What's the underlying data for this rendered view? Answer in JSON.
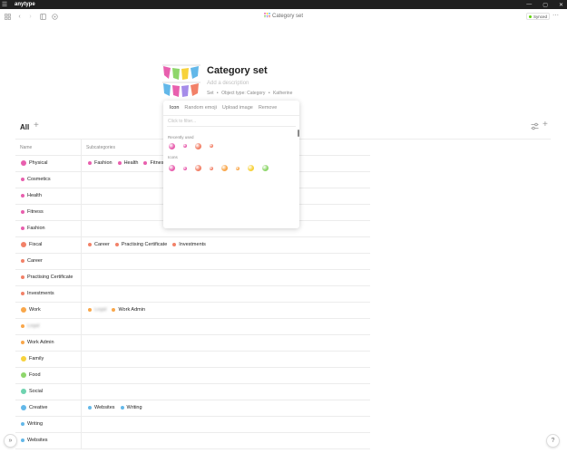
{
  "window": {
    "app_name": "anytype",
    "menu_icon": "hamburger-icon",
    "min_icon": "—",
    "max_icon": "▢",
    "close_icon": "✕"
  },
  "header": {
    "breadcrumb": "Category set",
    "sync_status": "Synced",
    "more_icon": "⋯"
  },
  "object": {
    "title": "Category set",
    "description_placeholder": "Add a description",
    "meta": [
      "Set",
      "•",
      "Object type: Category",
      "•",
      "Katherine"
    ]
  },
  "view": {
    "tab_label": "All",
    "add_view": "+",
    "add_row": "+"
  },
  "table": {
    "columns": [
      "Name",
      "Subcategories"
    ],
    "rows": [
      {
        "name": "Physical",
        "color": "#e85fae",
        "large": true,
        "subs": [
          {
            "label": "Fashion",
            "color": "#e85fae"
          },
          {
            "label": "Health",
            "color": "#e85fae"
          },
          {
            "label": "Fitness",
            "color": "#e85fae"
          }
        ]
      },
      {
        "name": "Cosmetics",
        "color": "#e85fae",
        "large": false,
        "subs": []
      },
      {
        "name": "Health",
        "color": "#e85fae",
        "large": false,
        "subs": []
      },
      {
        "name": "Fitness",
        "color": "#e85fae",
        "large": false,
        "subs": []
      },
      {
        "name": "Fashion",
        "color": "#e85fae",
        "large": false,
        "subs": []
      },
      {
        "name": "Fiscal",
        "color": "#f28168",
        "large": true,
        "subs": [
          {
            "label": "Career",
            "color": "#f28168"
          },
          {
            "label": "Practising Certificate",
            "color": "#f28168"
          },
          {
            "label": "Investments",
            "color": "#f28168"
          }
        ]
      },
      {
        "name": "Career",
        "color": "#f28168",
        "large": false,
        "subs": []
      },
      {
        "name": "Practising Certificate",
        "color": "#f28168",
        "large": false,
        "subs": []
      },
      {
        "name": "Investments",
        "color": "#f28168",
        "large": false,
        "subs": []
      },
      {
        "name": "Work",
        "color": "#f9a74b",
        "large": true,
        "subs": [
          {
            "label": "Legal",
            "color": "#f9a74b",
            "blurred": true
          },
          {
            "label": "Work Admin",
            "color": "#f9a74b"
          }
        ]
      },
      {
        "name": "Legal",
        "color": "#f9a74b",
        "large": false,
        "blurred": true,
        "subs": []
      },
      {
        "name": "Work Admin",
        "color": "#f9a74b",
        "large": false,
        "subs": []
      },
      {
        "name": "Family",
        "color": "#f7d23c",
        "large": true,
        "subs": []
      },
      {
        "name": "Food",
        "color": "#8ed66b",
        "large": true,
        "subs": []
      },
      {
        "name": "Social",
        "color": "#6fd3b0",
        "large": true,
        "subs": []
      },
      {
        "name": "Creative",
        "color": "#63b8e9",
        "large": true,
        "subs": [
          {
            "label": "Websites",
            "color": "#63b8e9"
          },
          {
            "label": "Writing",
            "color": "#63b8e9"
          }
        ]
      },
      {
        "name": "Writing",
        "color": "#63b8e9",
        "large": false,
        "subs": []
      },
      {
        "name": "Websites",
        "color": "#63b8e9",
        "large": false,
        "subs": []
      }
    ]
  },
  "popup": {
    "tabs": [
      "Icon",
      "Random emoji",
      "Upload image",
      "Remove"
    ],
    "filter_placeholder": "Click to filter...",
    "recent_label": "Recently used",
    "icons_label": "Icons",
    "recent_colors": [
      "#e85fae",
      "#e85fae",
      "#f28168",
      "#f28168"
    ],
    "recent_sizes": [
      "large",
      "small",
      "large",
      "small"
    ],
    "icon_colors": [
      "#e85fae",
      "#e85fae",
      "#f28168",
      "#f28168",
      "#f9a74b",
      "#f9a74b",
      "#f7d23c",
      "#8ed66b"
    ],
    "icon_sizes": [
      "large",
      "small",
      "large",
      "small",
      "large",
      "small",
      "large",
      "large"
    ]
  },
  "footer": {
    "expand_icon": "»",
    "help_icon": "?"
  }
}
